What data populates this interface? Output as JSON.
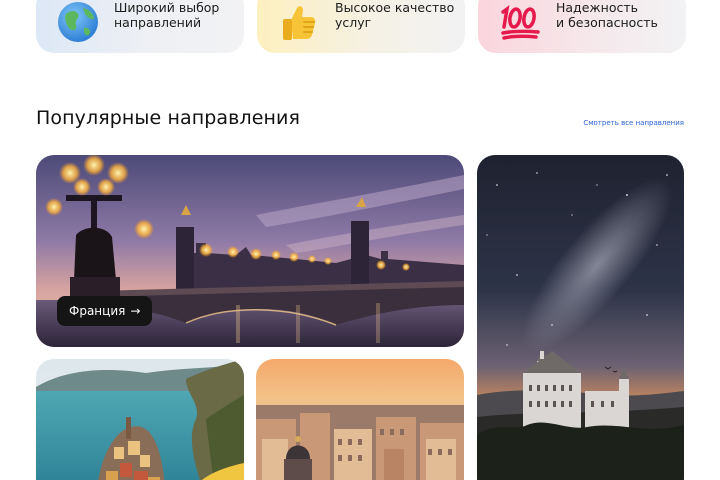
{
  "features": [
    {
      "icon": "globe-icon",
      "line1": "Широкий выбор",
      "line2": "направлений"
    },
    {
      "icon": "thumbs-up-icon",
      "line1": "Высокое качество",
      "line2": "услуг"
    },
    {
      "icon": "hundred-points-icon",
      "line1": "Надежность",
      "line2": "и безопасность"
    }
  ],
  "section": {
    "title": "Популярные направления",
    "see_all": "Смотреть все направления"
  },
  "destinations": {
    "france": {
      "label": "Франция",
      "arrow": "→"
    }
  },
  "colors": {
    "link": "#2a63d8",
    "pill_bg": "#151515"
  }
}
